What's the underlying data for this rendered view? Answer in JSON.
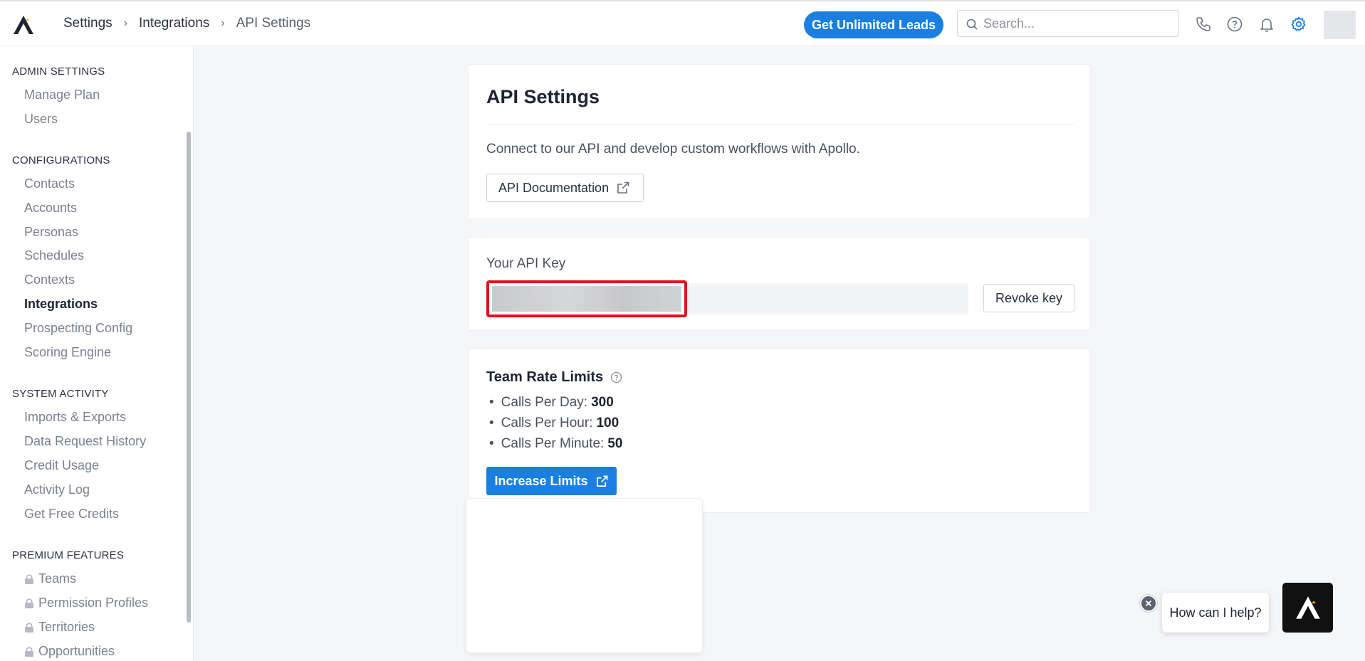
{
  "header": {
    "breadcrumbs": [
      "Settings",
      "Integrations",
      "API Settings"
    ],
    "cta_label": "Get Unlimited Leads",
    "search_placeholder": "Search...",
    "accent_color": "#1a7fe0"
  },
  "sidebar": {
    "sections": [
      {
        "title": "ADMIN SETTINGS",
        "items": [
          "Manage Plan",
          "Users"
        ]
      },
      {
        "title": "CONFIGURATIONS",
        "items": [
          "Contacts",
          "Accounts",
          "Personas",
          "Schedules",
          "Contexts",
          "Integrations",
          "Prospecting Config",
          "Scoring Engine"
        ]
      },
      {
        "title": "SYSTEM ACTIVITY",
        "items": [
          "Imports & Exports",
          "Data Request History",
          "Credit Usage",
          "Activity Log",
          "Get Free Credits"
        ]
      },
      {
        "title": "PREMIUM FEATURES",
        "items": [
          "Teams",
          "Permission Profiles",
          "Territories",
          "Opportunities"
        ]
      }
    ],
    "active_item": "Integrations"
  },
  "api_settings": {
    "title": "API Settings",
    "description": "Connect to our API and develop custom workflows with Apollo.",
    "doc_button": "API Documentation"
  },
  "api_key": {
    "label": "Your API Key",
    "revoke_button": "Revoke key"
  },
  "rate_limits": {
    "title": "Team Rate Limits",
    "items": [
      {
        "label": "Calls Per Day:",
        "value": "300"
      },
      {
        "label": "Calls Per Hour:",
        "value": "100"
      },
      {
        "label": "Calls Per Minute:",
        "value": "50"
      }
    ],
    "button": "Increase Limits"
  },
  "chat": {
    "prompt": "How can I help?"
  }
}
